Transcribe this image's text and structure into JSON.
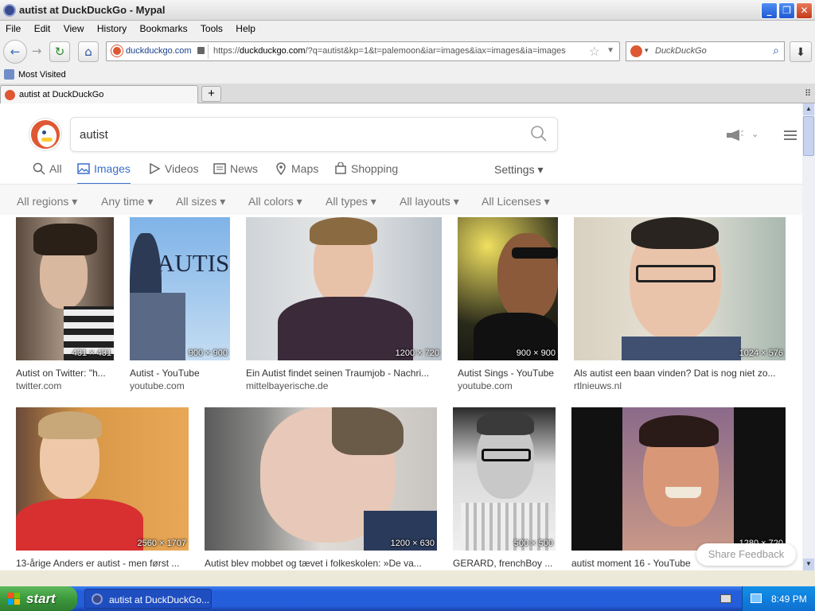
{
  "window": {
    "title": "autist at DuckDuckGo - Mypal",
    "minimize_glyph": "_",
    "maximize_glyph": "❐",
    "close_glyph": "✕"
  },
  "menu": [
    "File",
    "Edit",
    "View",
    "History",
    "Bookmarks",
    "Tools",
    "Help"
  ],
  "nav": {
    "site": "duckduckgo.com",
    "url_prefix": "https://",
    "url_host": "duckduckgo.com",
    "url_rest": "/?q=autist&kp=1&t=palemoon&iar=images&iax=images&ia=images",
    "search_placeholder": "DuckDuckGo"
  },
  "bookmarks": {
    "label": "Most Visited"
  },
  "tab": {
    "label": "autist at DuckDuckGo",
    "new_tab": "+"
  },
  "page": {
    "query": "autist",
    "tabs": [
      "All",
      "Images",
      "Videos",
      "News",
      "Maps",
      "Shopping"
    ],
    "active_tab": "Images",
    "settings": "Settings ▾",
    "filters": [
      "All regions ▾",
      "Any time ▾",
      "All sizes ▾",
      "All colors ▾",
      "All types ▾",
      "All layouts ▾",
      "All Licenses ▾"
    ],
    "results": [
      {
        "title": "Autist on Twitter: \"h...",
        "source": "twitter.com",
        "dims": "431 × 431"
      },
      {
        "title": "Autist - YouTube",
        "source": "youtube.com",
        "dims": "900 × 900",
        "overlay": "AUTIS"
      },
      {
        "title": "Ein Autist findet seinen Traumjob - Nachri...",
        "source": "mittelbayerische.de",
        "dims": "1200 × 720"
      },
      {
        "title": "Autist Sings - YouTube",
        "source": "youtube.com",
        "dims": "900 × 900"
      },
      {
        "title": "Als autist een baan vinden? Dat is nog niet zo...",
        "source": "rtlnieuws.nl",
        "dims": "1024 × 576"
      },
      {
        "title": "13-årige Anders er autist - men først ...",
        "source": "",
        "dims": "2560 × 1707"
      },
      {
        "title": "Autist blev mobbet og tævet i folkeskolen: »De va...",
        "source": "",
        "dims": "1200 × 630"
      },
      {
        "title": "GERARD, frenchBoy ...",
        "source": "",
        "dims": "500 × 500"
      },
      {
        "title": "autist moment 16 - YouTube",
        "source": "",
        "dims": "1280 × 720"
      }
    ],
    "feedback": "Share Feedback"
  },
  "taskbar": {
    "start": "start",
    "item": "autist at DuckDuckGo...",
    "clock": "8:49 PM"
  },
  "colors": {
    "accent": "#3b6ecb",
    "ddg_orange": "#de5833",
    "taskbar_blue": "#245edb",
    "start_green": "#3c9a3c"
  }
}
